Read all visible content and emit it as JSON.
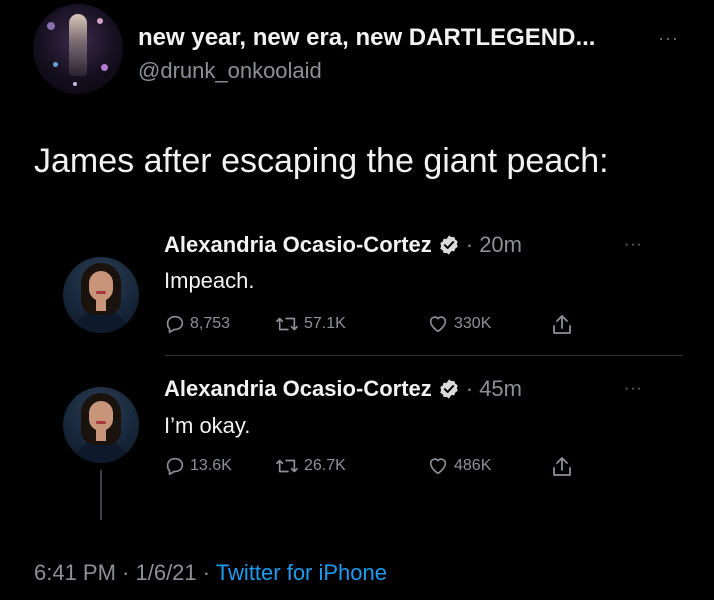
{
  "header": {
    "display_name": "new year, new era, new DARTLEGEND...",
    "handle": "@drunk_onkoolaid",
    "more": "···"
  },
  "tweet": {
    "text": "James after escaping the giant peach:"
  },
  "replies": [
    {
      "name": "Alexandria Ocasio-Cortez",
      "time": "· 20m",
      "text": "Impeach.",
      "more": "···",
      "replies_count": "8,753",
      "retweets_count": "57.1K",
      "likes_count": "330K"
    },
    {
      "name": "Alexandria Ocasio-Cortez",
      "time": "· 45m",
      "text": "I’m okay.",
      "more": "···",
      "replies_count": "13.6K",
      "retweets_count": "26.7K",
      "likes_count": "486K"
    }
  ],
  "footer": {
    "time_date": "6:41 PM · 1/6/21 · ",
    "source": "Twitter for iPhone"
  },
  "colors": {
    "background": "#000000",
    "text": "#e7e9ea",
    "muted": "#8b9197",
    "accent": "#1d9bf0",
    "divider": "#2f3336"
  },
  "icons": [
    "reply-icon",
    "retweet-icon",
    "like-icon",
    "share-icon",
    "verified-badge-icon",
    "more-icon"
  ]
}
